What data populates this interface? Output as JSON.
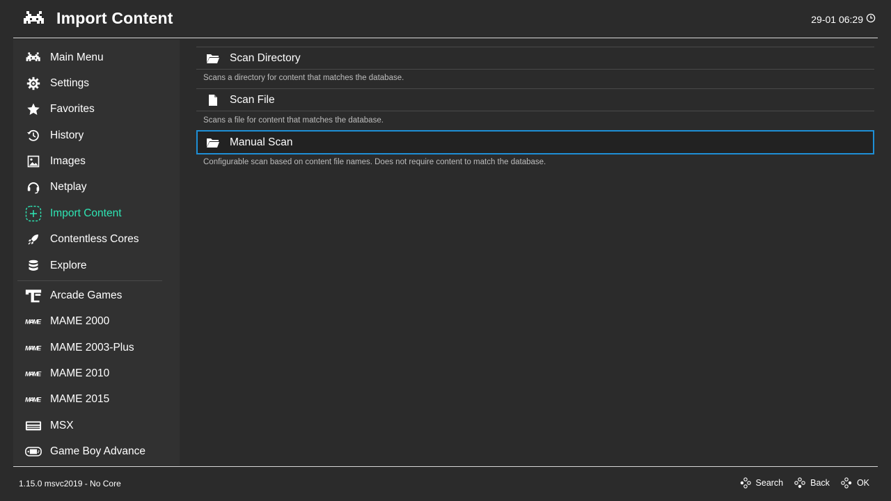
{
  "header": {
    "title": "Import Content",
    "clock": "29-01 06:29"
  },
  "sidebar": {
    "items": [
      {
        "label": "Main Menu",
        "icon": "invader-icon"
      },
      {
        "label": "Settings",
        "icon": "gear-icon"
      },
      {
        "label": "Favorites",
        "icon": "star-icon"
      },
      {
        "label": "History",
        "icon": "history-icon"
      },
      {
        "label": "Images",
        "icon": "image-icon"
      },
      {
        "label": "Netplay",
        "icon": "headset-icon"
      },
      {
        "label": "Import Content",
        "icon": "add-icon",
        "active": true
      },
      {
        "label": "Contentless Cores",
        "icon": "rocket-icon"
      },
      {
        "label": "Explore",
        "icon": "database-icon"
      }
    ],
    "playlists": [
      {
        "label": "Arcade Games",
        "icon": "arcade-icon"
      },
      {
        "label": "MAME 2000",
        "icon": "mame-icon"
      },
      {
        "label": "MAME 2003-Plus",
        "icon": "mame-icon"
      },
      {
        "label": "MAME 2010",
        "icon": "mame-icon"
      },
      {
        "label": "MAME 2015",
        "icon": "mame-icon"
      },
      {
        "label": "MSX",
        "icon": "msx-icon"
      },
      {
        "label": "Game Boy Advance",
        "icon": "gba-icon"
      }
    ]
  },
  "main": {
    "entries": [
      {
        "label": "Scan Directory",
        "description": "Scans a directory for content that matches the database.",
        "icon": "folder-icon"
      },
      {
        "label": "Scan File",
        "description": "Scans a file for content that matches the database.",
        "icon": "file-icon"
      },
      {
        "label": "Manual Scan",
        "description": "Configurable scan based on content file names. Does not require content to match the database.",
        "icon": "folder-icon",
        "selected": true
      }
    ]
  },
  "footer": {
    "version": "1.15.0 msvc2019 - No Core",
    "hints": [
      {
        "label": "Search",
        "icon": "gamepad-buttons-icon"
      },
      {
        "label": "Back",
        "icon": "gamepad-buttons-icon"
      },
      {
        "label": "OK",
        "icon": "gamepad-buttons-icon"
      }
    ]
  },
  "colors": {
    "background": "#2b2b2b",
    "sidebar": "#313131",
    "active": "#2ee6b4",
    "selection_border": "#1e8fd6"
  }
}
